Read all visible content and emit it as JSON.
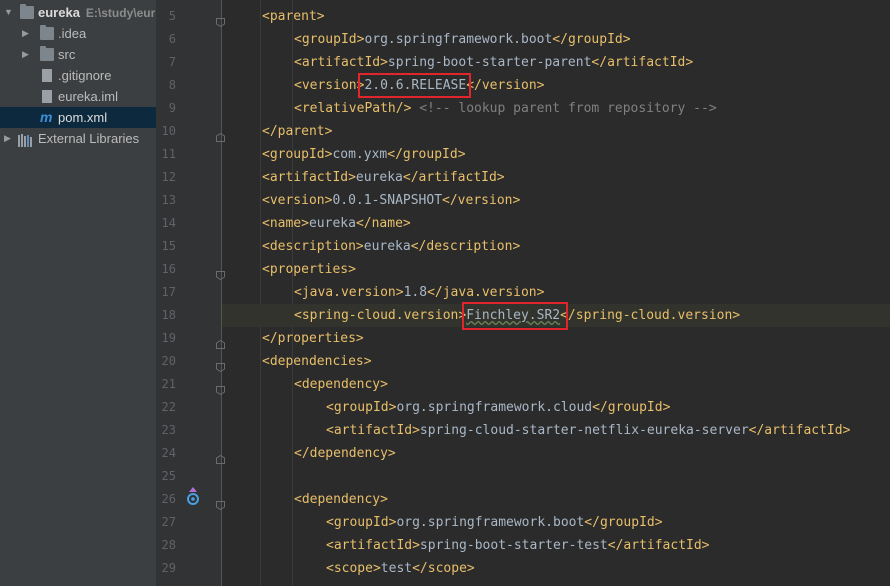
{
  "sidebar": {
    "root": {
      "label": "eureka",
      "path": "E:\\study\\eur"
    },
    "items": [
      {
        "label": ".idea",
        "type": "folder"
      },
      {
        "label": "src",
        "type": "folder"
      },
      {
        "label": ".gitignore",
        "type": "file"
      },
      {
        "label": "eureka.iml",
        "type": "file"
      },
      {
        "label": "pom.xml",
        "type": "xml",
        "selected": true
      },
      {
        "label": "External Libraries",
        "type": "library"
      }
    ]
  },
  "editor": {
    "line_numbers": [
      "5",
      "6",
      "7",
      "8",
      "9",
      "10",
      "11",
      "12",
      "13",
      "14",
      "15",
      "16",
      "17",
      "18",
      "19",
      "20",
      "21",
      "22",
      "23",
      "24",
      "25",
      "26",
      "27",
      "28",
      "29"
    ],
    "lines": [
      {
        "indent": 1,
        "parts": [
          {
            "t": "tag",
            "v": "<parent>"
          }
        ]
      },
      {
        "indent": 2,
        "parts": [
          {
            "t": "tag",
            "v": "<groupId>"
          },
          {
            "t": "txt",
            "v": "org.springframework.boot"
          },
          {
            "t": "tag",
            "v": "</groupId>"
          }
        ]
      },
      {
        "indent": 2,
        "parts": [
          {
            "t": "tag",
            "v": "<artifactId>"
          },
          {
            "t": "txt",
            "v": "spring-boot-starter-parent"
          },
          {
            "t": "tag",
            "v": "</artifactId>"
          }
        ]
      },
      {
        "indent": 2,
        "parts": [
          {
            "t": "tag",
            "v": "<version>"
          },
          {
            "t": "txt",
            "v": "2.0.6.RELEASE"
          },
          {
            "t": "tag",
            "v": "</version>"
          }
        ]
      },
      {
        "indent": 2,
        "parts": [
          {
            "t": "tag",
            "v": "<relativePath/>"
          },
          {
            "t": "cmt",
            "v": " <!-- lookup parent from repository -->"
          }
        ]
      },
      {
        "indent": 1,
        "parts": [
          {
            "t": "tag",
            "v": "</parent>"
          }
        ]
      },
      {
        "indent": 1,
        "parts": [
          {
            "t": "tag",
            "v": "<groupId>"
          },
          {
            "t": "txt",
            "v": "com.yxm"
          },
          {
            "t": "tag",
            "v": "</groupId>"
          }
        ]
      },
      {
        "indent": 1,
        "parts": [
          {
            "t": "tag",
            "v": "<artifactId>"
          },
          {
            "t": "txt",
            "v": "eureka"
          },
          {
            "t": "tag",
            "v": "</artifactId>"
          }
        ]
      },
      {
        "indent": 1,
        "parts": [
          {
            "t": "tag",
            "v": "<version>"
          },
          {
            "t": "txt",
            "v": "0.0.1-SNAPSHOT"
          },
          {
            "t": "tag",
            "v": "</version>"
          }
        ]
      },
      {
        "indent": 1,
        "parts": [
          {
            "t": "tag",
            "v": "<name>"
          },
          {
            "t": "txt",
            "v": "eureka"
          },
          {
            "t": "tag",
            "v": "</name>"
          }
        ]
      },
      {
        "indent": 1,
        "parts": [
          {
            "t": "tag",
            "v": "<description>"
          },
          {
            "t": "txt",
            "v": "eureka"
          },
          {
            "t": "tag",
            "v": "</description>"
          }
        ]
      },
      {
        "indent": 1,
        "parts": [
          {
            "t": "tag",
            "v": "<properties>"
          }
        ]
      },
      {
        "indent": 2,
        "parts": [
          {
            "t": "tag",
            "v": "<java.version>"
          },
          {
            "t": "txt",
            "v": "1.8"
          },
          {
            "t": "tag",
            "v": "</java.version>"
          }
        ]
      },
      {
        "indent": 2,
        "highlight": true,
        "parts": [
          {
            "t": "tag",
            "v": "<spring-cloud.version>"
          },
          {
            "t": "txt wavy",
            "v": "Finchley.SR2"
          },
          {
            "t": "tag",
            "v": "</spring-cloud.version>"
          }
        ]
      },
      {
        "indent": 1,
        "parts": [
          {
            "t": "tag",
            "v": "</properties>"
          }
        ]
      },
      {
        "indent": 1,
        "parts": [
          {
            "t": "tag",
            "v": "<dependencies>"
          }
        ]
      },
      {
        "indent": 2,
        "parts": [
          {
            "t": "tag",
            "v": "<dependency>"
          }
        ]
      },
      {
        "indent": 3,
        "parts": [
          {
            "t": "tag",
            "v": "<groupId>"
          },
          {
            "t": "txt",
            "v": "org.springframework.cloud"
          },
          {
            "t": "tag",
            "v": "</groupId>"
          }
        ]
      },
      {
        "indent": 3,
        "parts": [
          {
            "t": "tag",
            "v": "<artifactId>"
          },
          {
            "t": "txt",
            "v": "spring-cloud-starter-netflix-eureka-server"
          },
          {
            "t": "tag",
            "v": "</artifactId>"
          }
        ]
      },
      {
        "indent": 2,
        "parts": [
          {
            "t": "tag",
            "v": "</dependency>"
          }
        ]
      },
      {
        "indent": 0,
        "parts": []
      },
      {
        "indent": 2,
        "parts": [
          {
            "t": "tag",
            "v": "<dependency>"
          }
        ]
      },
      {
        "indent": 3,
        "parts": [
          {
            "t": "tag",
            "v": "<groupId>"
          },
          {
            "t": "txt",
            "v": "org.springframework.boot"
          },
          {
            "t": "tag",
            "v": "</groupId>"
          }
        ]
      },
      {
        "indent": 3,
        "parts": [
          {
            "t": "tag",
            "v": "<artifactId>"
          },
          {
            "t": "txt",
            "v": "spring-boot-starter-test"
          },
          {
            "t": "tag",
            "v": "</artifactId>"
          }
        ]
      },
      {
        "indent": 3,
        "parts": [
          {
            "t": "tag",
            "v": "<scope>"
          },
          {
            "t": "txt",
            "v": "test"
          },
          {
            "t": "tag",
            "v": "</scope>"
          }
        ]
      }
    ]
  },
  "colors": {
    "tag": "#e8bf6a",
    "text": "#a9b7c6",
    "comment": "#808080",
    "annotation_box": "#e0262b"
  },
  "icons": [
    "bulb-icon",
    "maven-override-icon"
  ]
}
